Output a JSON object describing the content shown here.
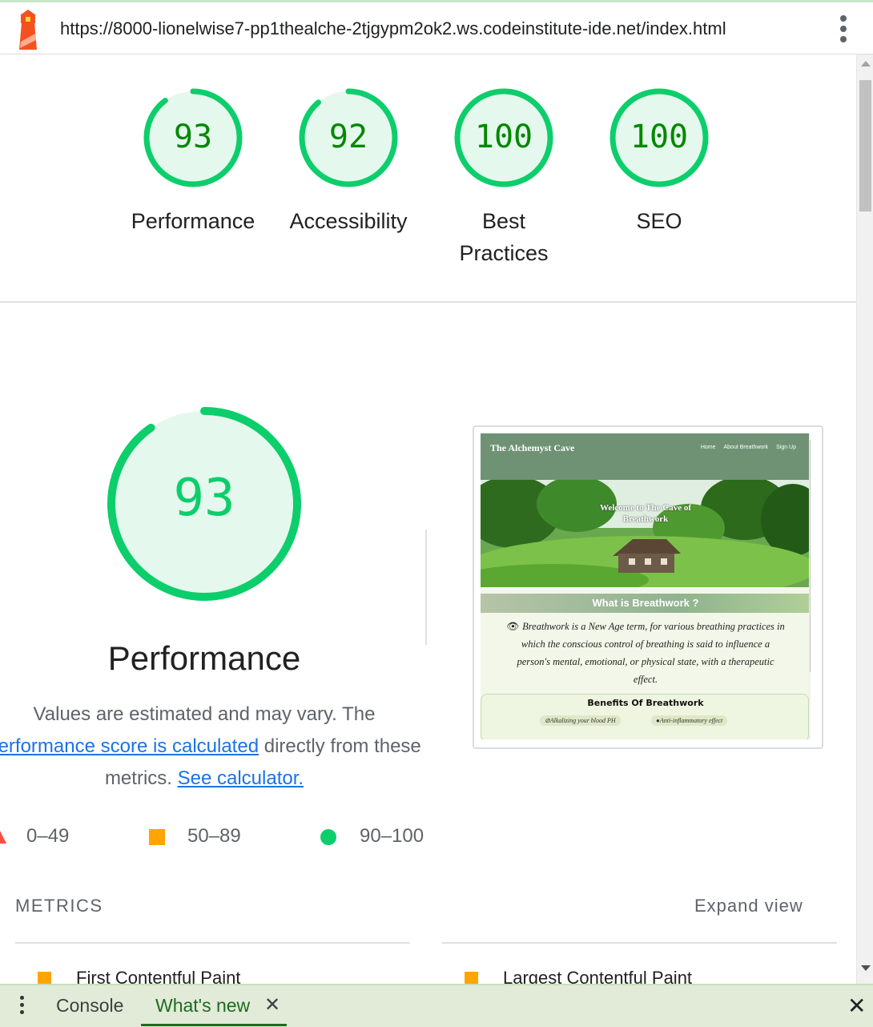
{
  "url_bar": {
    "url": "https://8000-lionelwise7-pp1thealche-2tjgypm2ok2.ws.codeinstitute-ide.net/index.html"
  },
  "scores": [
    {
      "value": "93",
      "label": "Performance",
      "score": 93
    },
    {
      "value": "92",
      "label": "Accessibility",
      "score": 92
    },
    {
      "value": "100",
      "label": "Best Practices",
      "score": 100
    },
    {
      "value": "100",
      "label": "SEO",
      "score": 100
    }
  ],
  "performance": {
    "score_text": "93",
    "score": 93,
    "title": "Performance",
    "desc_pre": "Values are estimated and may vary. The ",
    "desc_link": "performance score is calculated",
    "desc_mid": " directly from these metrics. ",
    "calc_link": "See calculator."
  },
  "legend": [
    {
      "range": "0–49",
      "shape": "triangle",
      "color": "#ff4e42"
    },
    {
      "range": "50–89",
      "shape": "square",
      "color": "#ffa400"
    },
    {
      "range": "90–100",
      "shape": "circle",
      "color": "#0cce6b"
    }
  ],
  "screenshot": {
    "brand": "The Alchemyst Cave",
    "nav": [
      "Home",
      "About Breathwork",
      "Sign Up"
    ],
    "hero_title_1": "Welcome to The Cave of",
    "hero_title_2": "Breathwork",
    "section_heading": "What is Breathwork ?",
    "paragraph": "Breathwork is a New Age term, for various breathing practices in which the conscious control of breathing is said to influence a person's mental, emotional, or physical state, with a therapeutic effect.",
    "box_title": "Benefits Of Breathwork",
    "chips": [
      "Alkalizing your blood PH",
      "Anti-inflammatory effect"
    ]
  },
  "metrics": {
    "header": "METRICS",
    "expand": "Expand view",
    "items": [
      "First Contentful Paint",
      "Largest Contentful Paint"
    ]
  },
  "drawer": {
    "tabs": [
      "Console",
      "What's new"
    ],
    "tab_close": "✕",
    "close": "✕"
  },
  "colors": {
    "pass": "#0cce6b",
    "pass_dark": "#008800",
    "average": "#ffa400",
    "fail": "#ff4e42",
    "gauge_fill": "#e5f8ed"
  }
}
